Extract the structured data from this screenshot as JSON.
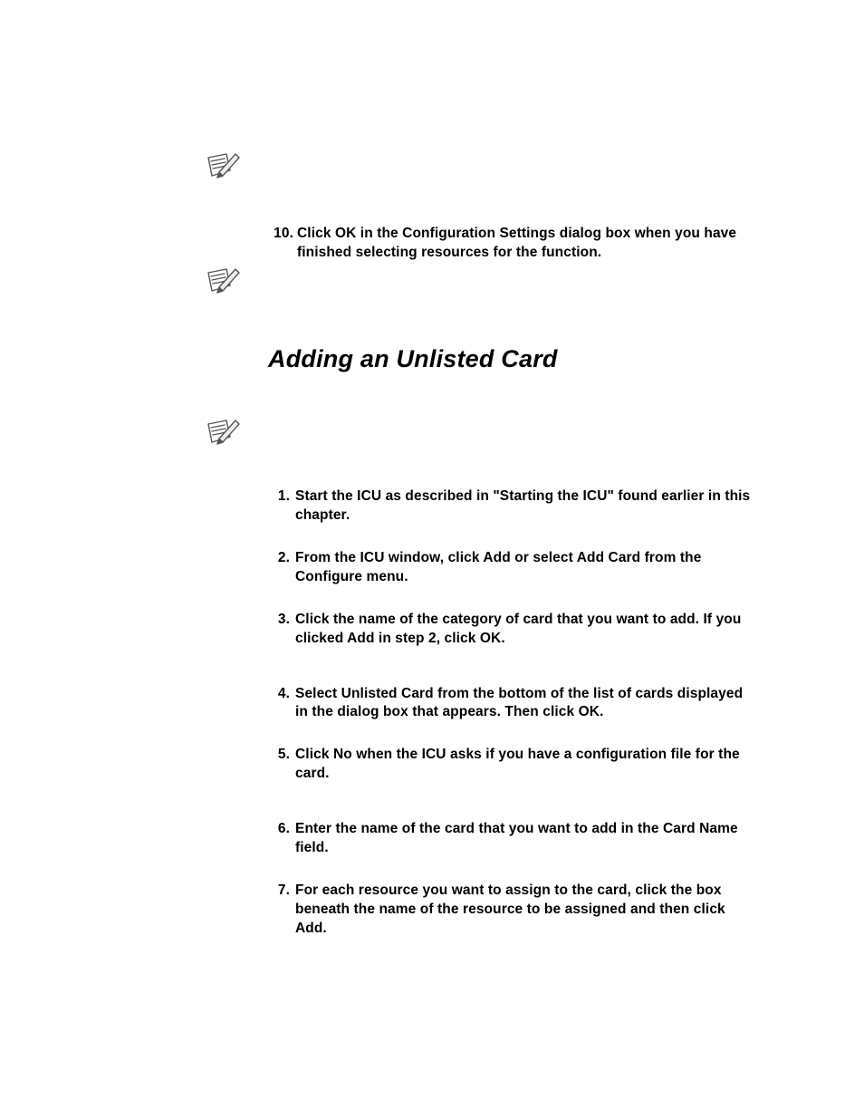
{
  "step10": {
    "number": "10.",
    "text": "Click OK in the Configuration Settings dialog box when you have finished selecting resources for the function."
  },
  "heading": "Adding an Unlisted Card",
  "steps": [
    {
      "number": "1.",
      "text": "Start the ICU as described in \"Starting the ICU\" found earlier in this chapter."
    },
    {
      "number": "2.",
      "text": "From the ICU window, click Add or select Add Card from the Configure menu."
    },
    {
      "number": "3.",
      "text": "Click the name of the category of card that you want to add. If you clicked Add in step 2, click OK."
    },
    {
      "number": "4.",
      "text": "Select Unlisted Card from the bottom of the list of cards displayed in the dialog box that appears. Then click OK."
    },
    {
      "number": "5.",
      "text": "Click No when the ICU asks if you have a configuration file for the card."
    },
    {
      "number": "6.",
      "text": "Enter the name of the card that you want to add in the Card Name field."
    },
    {
      "number": "7.",
      "text": "For each resource you want to assign to the card, click the box beneath the name of the resource to be assigned and then click Add."
    }
  ]
}
